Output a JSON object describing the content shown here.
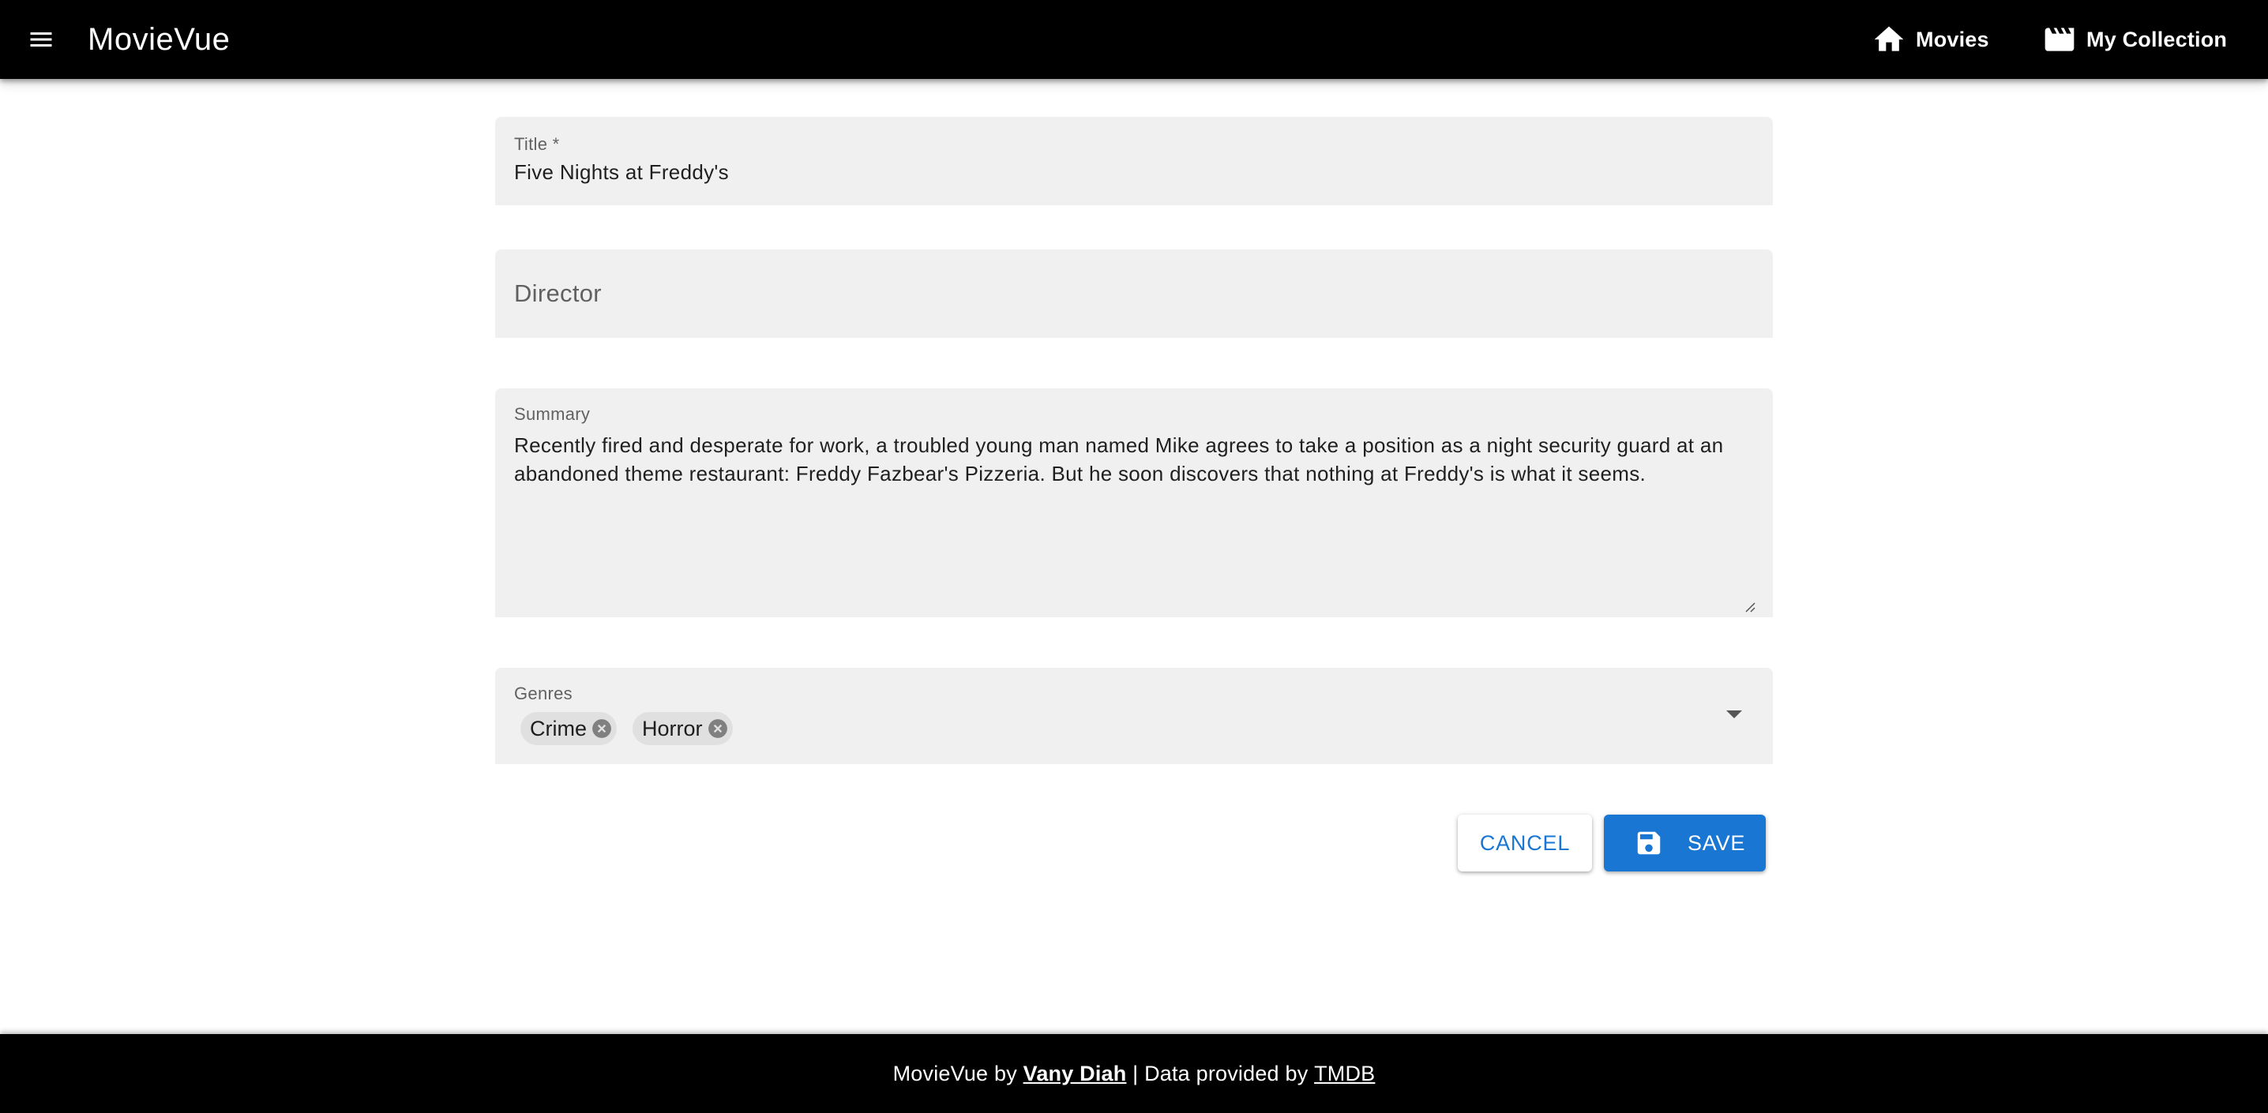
{
  "appbar": {
    "title": "MovieVue",
    "nav": [
      {
        "label": "Movies",
        "icon": "home-icon"
      },
      {
        "label": "My Collection",
        "icon": "movie-clapper-icon"
      }
    ]
  },
  "form": {
    "title": {
      "label": "Title *",
      "value": "Five Nights at Freddy's"
    },
    "director": {
      "label": "Director",
      "value": ""
    },
    "summary": {
      "label": "Summary",
      "value": "Recently fired and desperate for work, a troubled young man named Mike agrees to take a position as a night security guard at an abandoned theme restaurant: Freddy Fazbear's Pizzeria. But he soon discovers that nothing at Freddy's is what it seems."
    },
    "genres": {
      "label": "Genres",
      "selected": [
        "Crime",
        "Horror"
      ]
    },
    "actions": {
      "cancel": "CANCEL",
      "save": "SAVE"
    }
  },
  "footer": {
    "prefix": "MovieVue by ",
    "author": "Vany Diah",
    "middle": " | Data provided by ",
    "source": "TMDB"
  },
  "colors": {
    "appbar_bg": "#000000",
    "field_bg": "#f0f0f0",
    "primary": "#1976d2",
    "chip_bg": "#e0e0e0"
  }
}
